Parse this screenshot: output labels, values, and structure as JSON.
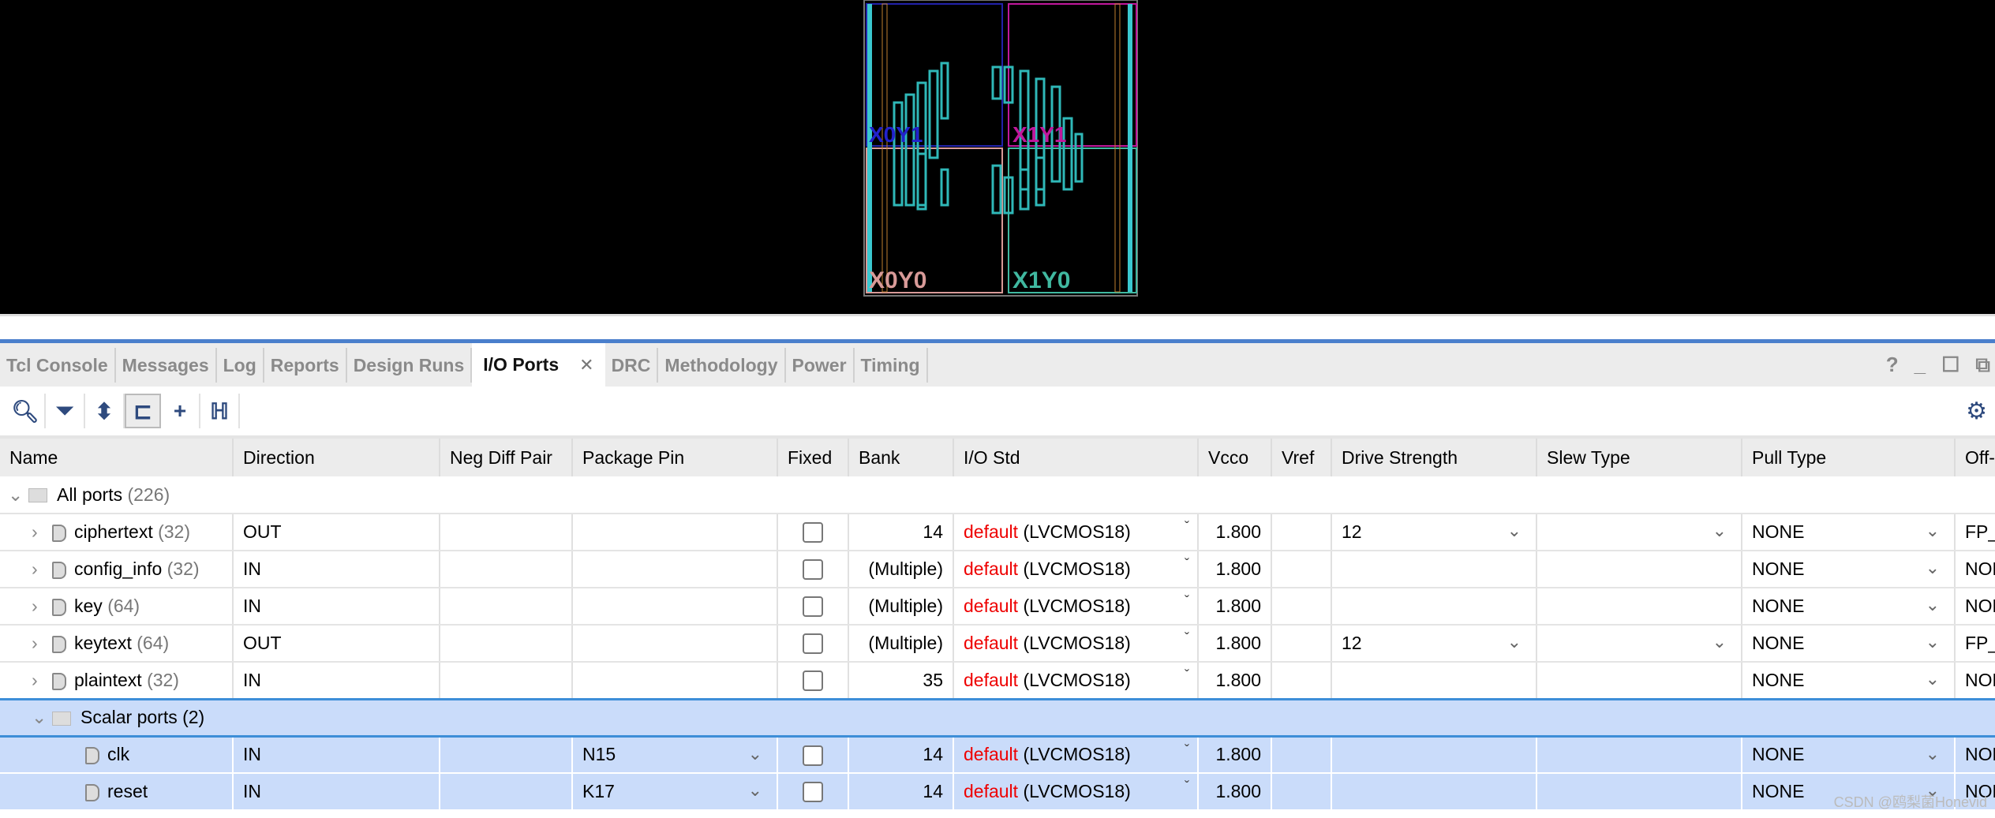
{
  "device": {
    "clock_regions": [
      "X0Y1",
      "X1Y1",
      "X0Y0",
      "X1Y0"
    ]
  },
  "tabs": [
    "Tcl Console",
    "Messages",
    "Log",
    "Reports",
    "Design Runs",
    "I/O Ports",
    "DRC",
    "Methodology",
    "Power",
    "Timing"
  ],
  "active_tab": "I/O Ports",
  "window_controls": {
    "help": "?",
    "minimize": "_",
    "maximize": "☐",
    "float": "⧉"
  },
  "columns": [
    "Name",
    "Direction",
    "Neg Diff Pair",
    "Package Pin",
    "Fixed",
    "Bank",
    "I/O Std",
    "Vcco",
    "Vref",
    "Drive Strength",
    "Slew Type",
    "Pull Type",
    "Off-C"
  ],
  "root": {
    "label": "All ports",
    "count": "(226)"
  },
  "buses": [
    {
      "name": "ciphertext",
      "count": "(32)",
      "dir": "OUT",
      "bank": "14",
      "std_default": "default",
      "std": "(LVCMOS18)",
      "vcco": "1.800",
      "drive": "12",
      "pull": "NONE",
      "off": "FP_"
    },
    {
      "name": "config_info",
      "count": "(32)",
      "dir": "IN",
      "bank": "(Multiple)",
      "std_default": "default",
      "std": "(LVCMOS18)",
      "vcco": "1.800",
      "drive": "",
      "pull": "NONE",
      "off": "NON"
    },
    {
      "name": "key",
      "count": "(64)",
      "dir": "IN",
      "bank": "(Multiple)",
      "std_default": "default",
      "std": "(LVCMOS18)",
      "vcco": "1.800",
      "drive": "",
      "pull": "NONE",
      "off": "NON"
    },
    {
      "name": "keytext",
      "count": "(64)",
      "dir": "OUT",
      "bank": "(Multiple)",
      "std_default": "default",
      "std": "(LVCMOS18)",
      "vcco": "1.800",
      "drive": "12",
      "pull": "NONE",
      "off": "FP_"
    },
    {
      "name": "plaintext",
      "count": "(32)",
      "dir": "IN",
      "bank": "35",
      "std_default": "default",
      "std": "(LVCMOS18)",
      "vcco": "1.800",
      "drive": "",
      "pull": "NONE",
      "off": "NON"
    }
  ],
  "scalar_group": {
    "label": "Scalar ports (2)"
  },
  "scalars": [
    {
      "name": "clk",
      "dir": "IN",
      "pin": "N15",
      "bank": "14",
      "std_default": "default",
      "std": "(LVCMOS18)",
      "vcco": "1.800",
      "pull": "NONE",
      "off": "NON"
    },
    {
      "name": "reset",
      "dir": "IN",
      "pin": "K17",
      "bank": "14",
      "std_default": "default",
      "std": "(LVCMOS18)",
      "vcco": "1.800",
      "pull": "NONE",
      "off": "NON"
    }
  ],
  "watermark": "CSDN @鸥梨菌Honevid"
}
